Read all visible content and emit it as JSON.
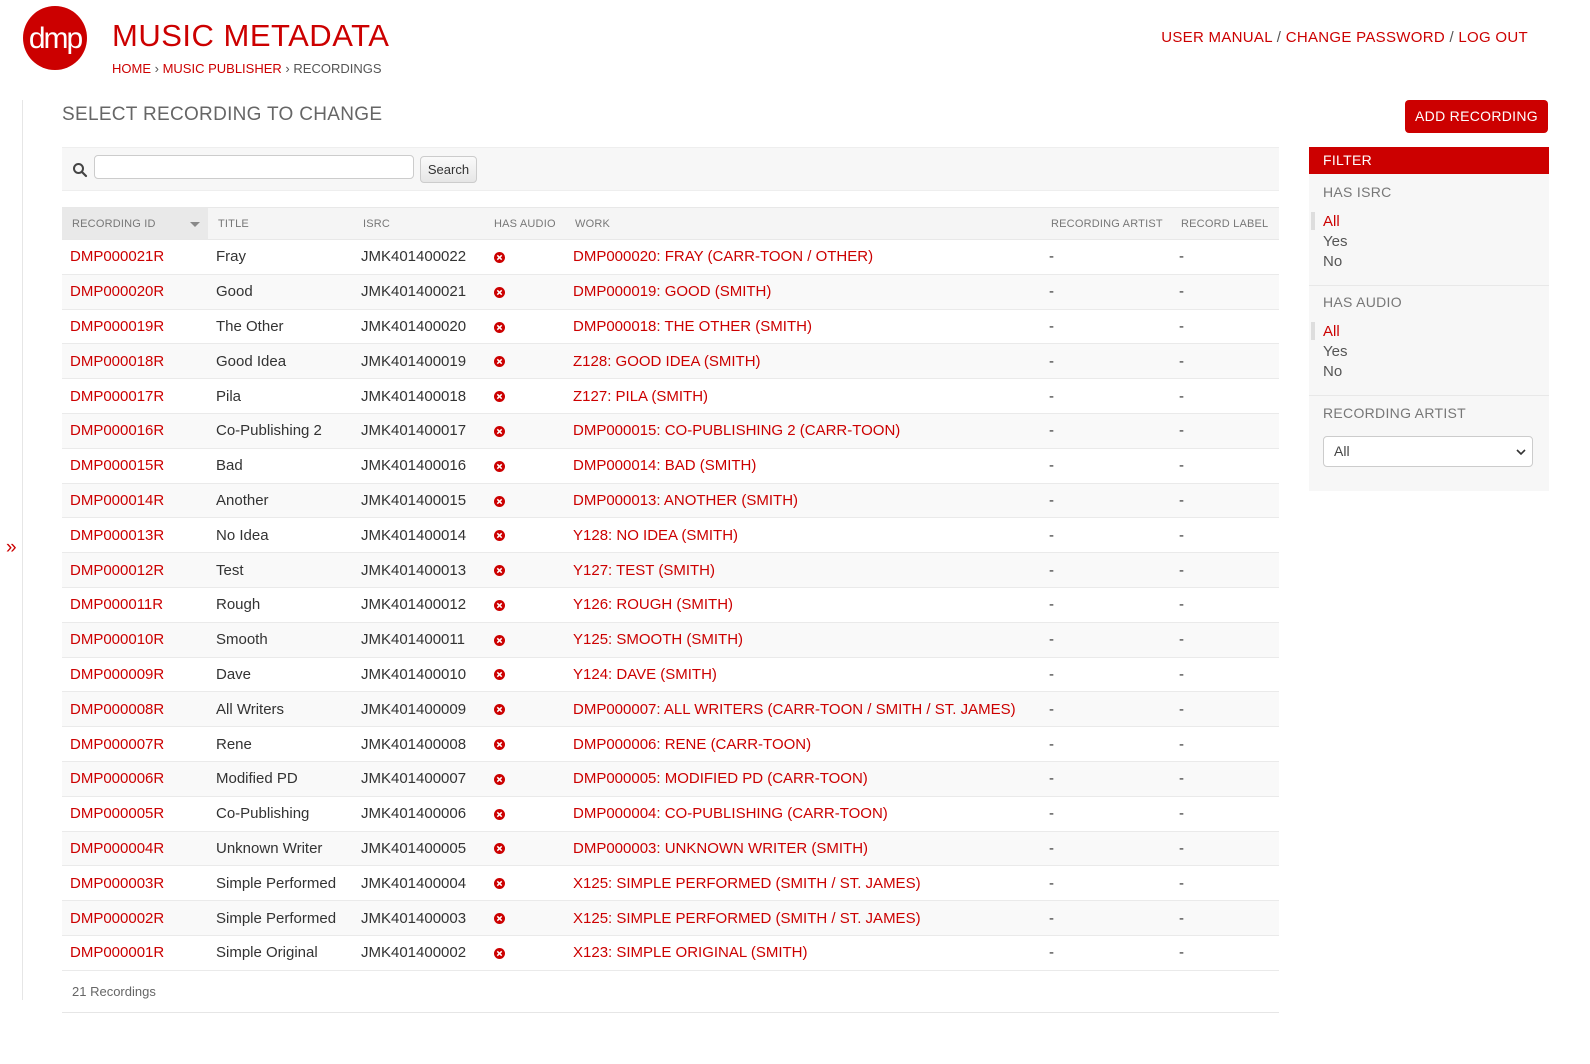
{
  "header": {
    "logo_text": "dmp",
    "brand": "MUSIC METADATA",
    "breadcrumb": {
      "home": "HOME",
      "sep1": "›",
      "section": "MUSIC PUBLISHER",
      "sep2": "›",
      "current": "RECORDINGS"
    },
    "user_tools": {
      "manual": "USER MANUAL",
      "sep1": "/",
      "change_password": "CHANGE PASSWORD",
      "sep2": "/",
      "logout": "LOG OUT"
    }
  },
  "sidebar_toggle": "»",
  "page_title": "SELECT RECORDING TO CHANGE",
  "add_button": "ADD RECORDING",
  "search": {
    "value": "",
    "button": "Search"
  },
  "table": {
    "columns": [
      "RECORDING ID",
      "TITLE",
      "ISRC",
      "HAS AUDIO",
      "WORK",
      "RECORDING ARTIST",
      "RECORD LABEL"
    ],
    "has_audio_icon": "no-audio-x-icon",
    "rows": [
      {
        "id": "DMP000021R",
        "title": "Fray",
        "isrc": "JMK401400022",
        "work": "DMP000020: FRAY (CARR-TOON / OTHER)",
        "artist": "-",
        "label": "-"
      },
      {
        "id": "DMP000020R",
        "title": "Good",
        "isrc": "JMK401400021",
        "work": "DMP000019: GOOD (SMITH)",
        "artist": "-",
        "label": "-"
      },
      {
        "id": "DMP000019R",
        "title": "The Other",
        "isrc": "JMK401400020",
        "work": "DMP000018: THE OTHER (SMITH)",
        "artist": "-",
        "label": "-"
      },
      {
        "id": "DMP000018R",
        "title": "Good Idea",
        "isrc": "JMK401400019",
        "work": "Z128: GOOD IDEA (SMITH)",
        "artist": "-",
        "label": "-"
      },
      {
        "id": "DMP000017R",
        "title": "Pila",
        "isrc": "JMK401400018",
        "work": "Z127: PILA (SMITH)",
        "artist": "-",
        "label": "-"
      },
      {
        "id": "DMP000016R",
        "title": "Co-Publishing 2",
        "isrc": "JMK401400017",
        "work": "DMP000015: CO-PUBLISHING 2 (CARR-TOON)",
        "artist": "-",
        "label": "-"
      },
      {
        "id": "DMP000015R",
        "title": "Bad",
        "isrc": "JMK401400016",
        "work": "DMP000014: BAD (SMITH)",
        "artist": "-",
        "label": "-"
      },
      {
        "id": "DMP000014R",
        "title": "Another",
        "isrc": "JMK401400015",
        "work": "DMP000013: ANOTHER (SMITH)",
        "artist": "-",
        "label": "-"
      },
      {
        "id": "DMP000013R",
        "title": "No Idea",
        "isrc": "JMK401400014",
        "work": "Y128: NO IDEA (SMITH)",
        "artist": "-",
        "label": "-"
      },
      {
        "id": "DMP000012R",
        "title": "Test",
        "isrc": "JMK401400013",
        "work": "Y127: TEST (SMITH)",
        "artist": "-",
        "label": "-"
      },
      {
        "id": "DMP000011R",
        "title": "Rough",
        "isrc": "JMK401400012",
        "work": "Y126: ROUGH (SMITH)",
        "artist": "-",
        "label": "-"
      },
      {
        "id": "DMP000010R",
        "title": "Smooth",
        "isrc": "JMK401400011",
        "work": "Y125: SMOOTH (SMITH)",
        "artist": "-",
        "label": "-"
      },
      {
        "id": "DMP000009R",
        "title": "Dave",
        "isrc": "JMK401400010",
        "work": "Y124: DAVE (SMITH)",
        "artist": "-",
        "label": "-"
      },
      {
        "id": "DMP000008R",
        "title": "All Writers",
        "isrc": "JMK401400009",
        "work": "DMP000007: ALL WRITERS (CARR-TOON / SMITH / ST. JAMES)",
        "artist": "-",
        "label": "-"
      },
      {
        "id": "DMP000007R",
        "title": "Rene",
        "isrc": "JMK401400008",
        "work": "DMP000006: RENE (CARR-TOON)",
        "artist": "-",
        "label": "-"
      },
      {
        "id": "DMP000006R",
        "title": "Modified PD",
        "isrc": "JMK401400007",
        "work": "DMP000005: MODIFIED PD (CARR-TOON)",
        "artist": "-",
        "label": "-"
      },
      {
        "id": "DMP000005R",
        "title": "Co-Publishing",
        "isrc": "JMK401400006",
        "work": "DMP000004: CO-PUBLISHING (CARR-TOON)",
        "artist": "-",
        "label": "-"
      },
      {
        "id": "DMP000004R",
        "title": "Unknown Writer",
        "isrc": "JMK401400005",
        "work": "DMP000003: UNKNOWN WRITER (SMITH)",
        "artist": "-",
        "label": "-"
      },
      {
        "id": "DMP000003R",
        "title": "Simple Performed",
        "isrc": "JMK401400004",
        "work": "X125: SIMPLE PERFORMED (SMITH / ST. JAMES)",
        "artist": "-",
        "label": "-"
      },
      {
        "id": "DMP000002R",
        "title": "Simple Performed",
        "isrc": "JMK401400003",
        "work": "X125: SIMPLE PERFORMED (SMITH / ST. JAMES)",
        "artist": "-",
        "label": "-"
      },
      {
        "id": "DMP000001R",
        "title": "Simple Original",
        "isrc": "JMK401400002",
        "work": "X123: SIMPLE ORIGINAL (SMITH)",
        "artist": "-",
        "label": "-"
      }
    ]
  },
  "result_count": "21 Recordings",
  "filter": {
    "title": "FILTER",
    "has_isrc": {
      "title": "HAS ISRC",
      "options": [
        "All",
        "Yes",
        "No"
      ],
      "selected": "All"
    },
    "has_audio": {
      "title": "HAS AUDIO",
      "options": [
        "All",
        "Yes",
        "No"
      ],
      "selected": "All"
    },
    "recording_artist": {
      "title": "RECORDING ARTIST",
      "selected": "All"
    }
  },
  "colors": {
    "accent": "#cc0000",
    "text": "#333333",
    "muted": "#777777",
    "panel": "#f7f7f7"
  }
}
